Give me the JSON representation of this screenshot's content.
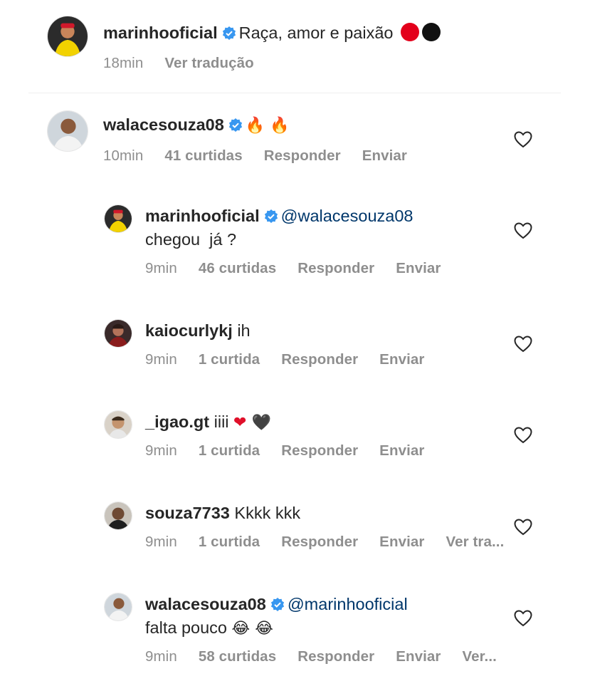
{
  "caption": {
    "username": "marinhooficial",
    "text": "Raça, amor e paixão",
    "dots": [
      "#e3001b",
      "#111111"
    ],
    "time": "18min",
    "translate": "Ver tradução"
  },
  "comments": [
    {
      "username": "walacesouza08",
      "verified": true,
      "emoji": "🔥 🔥",
      "time": "10min",
      "likes": "41 curtidas",
      "reply": "Responder",
      "send": "Enviar"
    },
    {
      "username": "marinhooficial",
      "verified": true,
      "mention": "@walacesouza08",
      "text": "chegou  já ?",
      "time": "9min",
      "likes": "46 curtidas",
      "reply": "Responder",
      "send": "Enviar"
    },
    {
      "username": "kaiocurlykj",
      "text": "ih",
      "time": "9min",
      "likes": "1 curtida",
      "reply": "Responder",
      "send": "Enviar"
    },
    {
      "username": "_igao.gt",
      "text": "iiii",
      "emoji": "❤ 🖤",
      "time": "9min",
      "likes": "1 curtida",
      "reply": "Responder",
      "send": "Enviar"
    },
    {
      "username": "souza7733",
      "text": "Kkkk kkk",
      "time": "9min",
      "likes": "1 curtida",
      "reply": "Responder",
      "send": "Enviar",
      "translate": "Ver tra..."
    },
    {
      "username": "walacesouza08",
      "verified": true,
      "mention": "@marinhooficial",
      "text": "falta pouco",
      "emoji": "😂 😂",
      "time": "9min",
      "likes": "58 curtidas",
      "reply": "Responder",
      "send": "Enviar",
      "translate": "Ver..."
    }
  ],
  "icons": {
    "verified": "verified-badge-icon",
    "like": "heart-outline-icon"
  },
  "colors": {
    "verified": "#3897f0",
    "mention": "#00376b",
    "meta": "#8e8e8e"
  }
}
